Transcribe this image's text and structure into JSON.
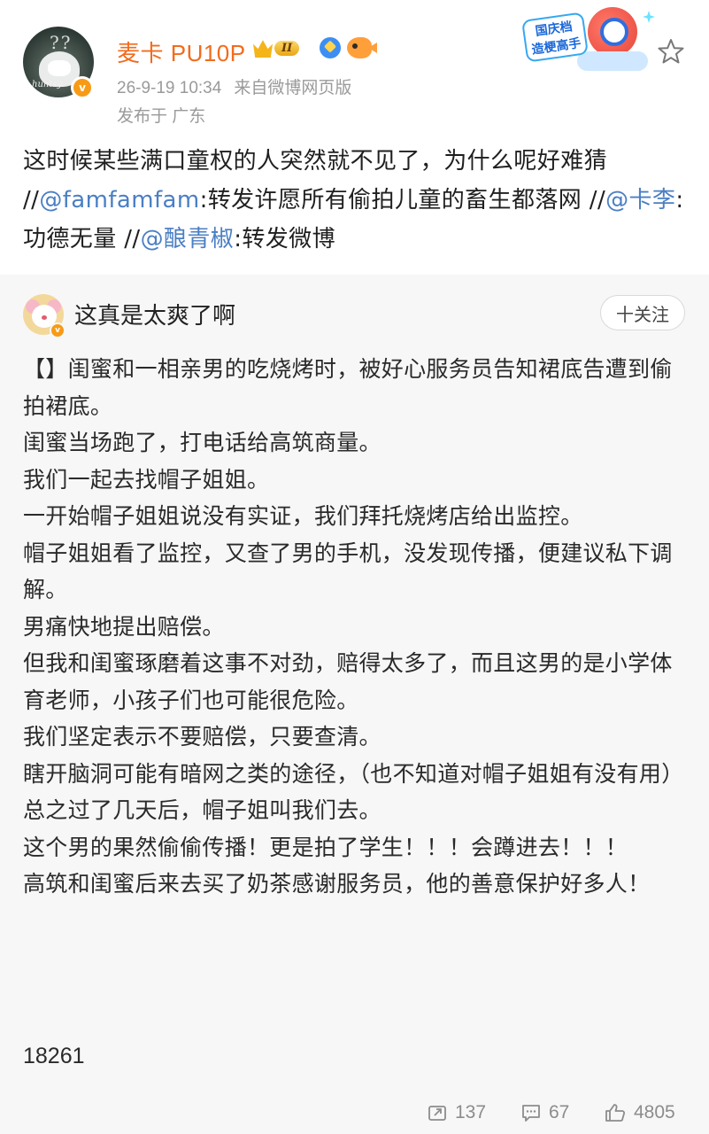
{
  "post": {
    "author": {
      "name": "麦卡 PU10P",
      "level_badge": "II",
      "verified_mark": "v",
      "avatar_watermark": "huntsy."
    },
    "timestamp": "26-9-19 10:34",
    "source": "来自微博网页版",
    "location": "发布于 广东",
    "event_badge_label": "国庆档\n造梗高手",
    "text_parts": {
      "t1": "这时候某些满口童权的人突然就不见了，为什么呢好难猜 //",
      "m1": "@famfamfam",
      "t2": ":转发许愿所有偷拍儿童的畜生都落网 //",
      "m2": "@卡李",
      "t3": ":功德无量 //",
      "m3": "@酿青椒",
      "t4": ":转发微博"
    }
  },
  "retweet": {
    "author_name": "这真是太爽了啊",
    "follow_label": "十关注",
    "verified_mark": "v",
    "lines": [
      "【】闺蜜和一相亲男的吃烧烤时，被好心服务员告知裙底告遭到偷拍裙底。",
      "闺蜜当场跑了，打电话给高筑商量。",
      "我们一起去找帽子姐姐。",
      "一开始帽子姐姐说没有实证，我们拜托烧烤店给出监控。",
      "帽子姐姐看了监控，又查了男的手机，没发现传播，便建议私下调解。",
      "男痛快地提出赔偿。",
      "但我和闺蜜琢磨着这事不对劲，赔得太多了，而且这男的是小学体育老师，小孩子们也可能很危险。",
      "我们坚定表示不要赔偿，只要查清。",
      "瞎开脑洞可能有暗网之类的途径，（也不知道对帽子姐姐有没有用）",
      "总之过了几天后，帽子姐叫我们去。",
      "这个男的果然偷偷传播！更是拍了学生！！！会蹲进去！！！",
      "高筑和闺蜜后来去买了奶茶感谢服务员，他的善意保护好多人！"
    ],
    "count_text": "18261"
  },
  "stats": {
    "reposts": "137",
    "comments": "67",
    "likes": "4805"
  },
  "colors": {
    "username": "#f26b1d",
    "mention": "#4a7fc4",
    "meta": "#9a9a9a",
    "card_bg": "#f7f7f7"
  },
  "icons": [
    "star-icon",
    "repost-icon",
    "comment-icon",
    "like-icon",
    "crown-icon",
    "verified-icon"
  ]
}
